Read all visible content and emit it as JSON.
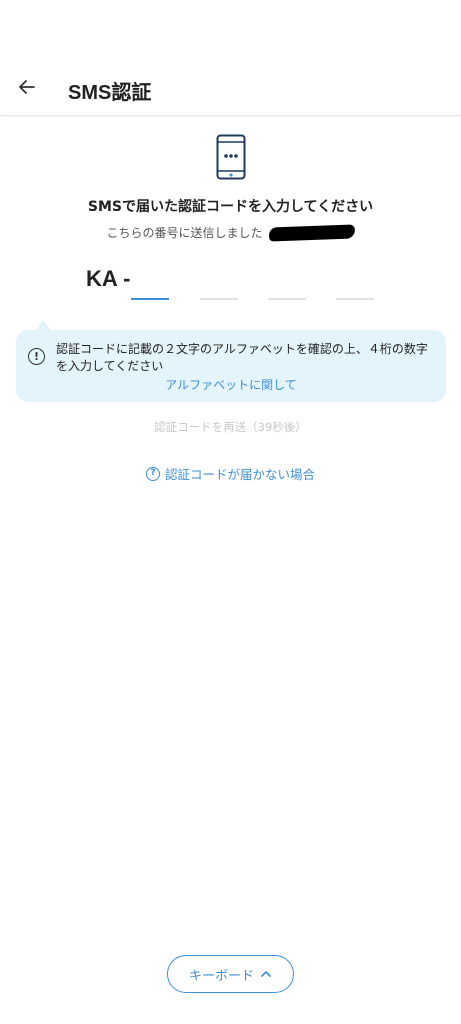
{
  "header": {
    "back_icon": "arrow-left-icon",
    "title": "SMS認証"
  },
  "main": {
    "phone_icon": "smartphone-dots-icon",
    "title": "SMSで届いた認証コードを入力してください",
    "subtitle": "こちらの番号に送信しました",
    "code_prefix": "KA -",
    "code_slots": [
      "",
      "",
      "",
      ""
    ],
    "active_slot": 0
  },
  "info": {
    "icon": "info-icon",
    "icon_glyph": "!",
    "text": "認証コードに記載の２文字のアルファベットを確認の上、４桁の数字を入力してください",
    "link": "アルファベットに関して"
  },
  "resend": {
    "label": "認証コードを再送（39秒後）"
  },
  "help": {
    "icon": "question-circle-icon",
    "icon_glyph": "?",
    "label": "認証コードが届かない場合"
  },
  "keyboard": {
    "label": "キーボード",
    "icon": "chevron-up-icon"
  },
  "colors": {
    "accent": "#3f8fd6",
    "info_bg": "#e4f4fb",
    "disabled_text": "#c8c8c8"
  }
}
